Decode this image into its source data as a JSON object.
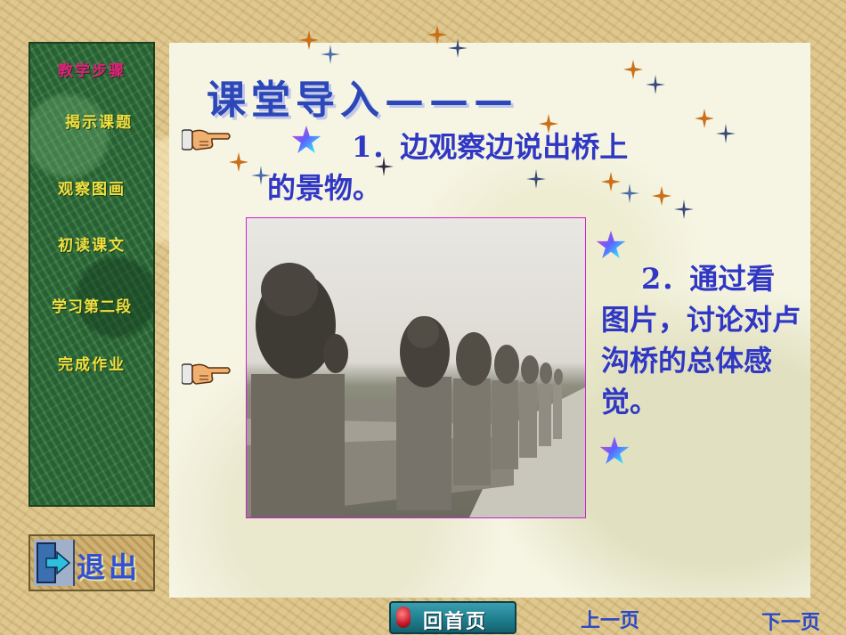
{
  "nav": {
    "items": [
      {
        "label": "教学步骤",
        "active": true
      },
      {
        "label": "揭示课题",
        "active": false
      },
      {
        "label": "观察图画",
        "active": false
      },
      {
        "label": "初读课文",
        "active": false
      },
      {
        "label": "学习第二段",
        "active": false
      },
      {
        "label": "完成作业",
        "active": false
      }
    ]
  },
  "slide": {
    "title": "课堂导入———",
    "question1": "1．边观察边说出桥上的景物。",
    "question2": "2．通过看图片，讨论对卢沟桥的总体感觉。"
  },
  "buttons": {
    "exit_label": "退出",
    "home_label": "回首页",
    "prev_label": "上一页",
    "next_label": "下一页"
  },
  "icons": {
    "pointer": "pointing-hand-icon",
    "star": "star-icon",
    "sparkle": "sparkle-icon",
    "exit": "exit-door-icon"
  },
  "colors": {
    "title": "#2b47b8",
    "body_text": "#2f37c4",
    "nav_text": "#f0e040",
    "nav_active": "#e0207a",
    "nav_bg": "#2f6b3a",
    "photo_border": "#d020d0"
  }
}
